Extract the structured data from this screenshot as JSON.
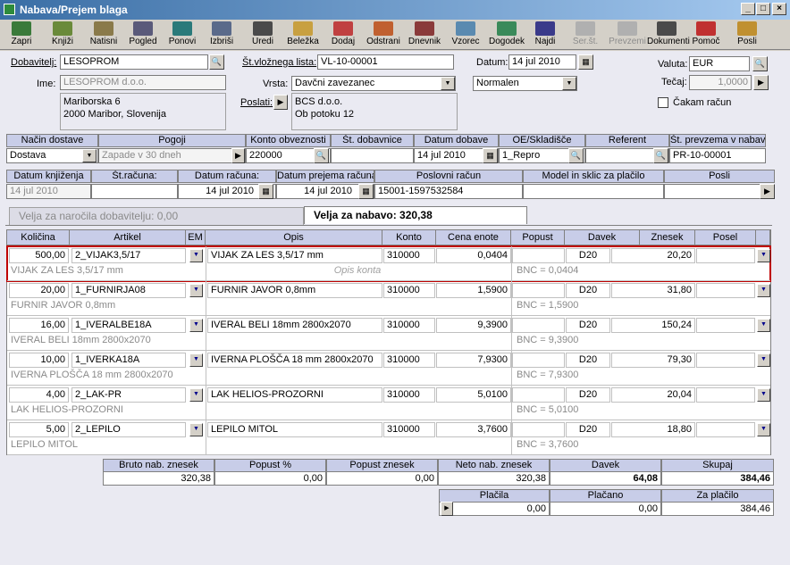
{
  "window": {
    "title": "Nabava/Prejem blaga"
  },
  "toolbar": [
    {
      "label": "Zapri",
      "icon": "close-door-icon",
      "color": "#3a7a3a",
      "enabled": true
    },
    {
      "label": "Knjiži",
      "icon": "book-icon",
      "color": "#6a8a3a",
      "enabled": true
    },
    {
      "label": "Natisni",
      "icon": "print-icon",
      "color": "#8a7a4a",
      "enabled": true
    },
    {
      "label": "Pogled",
      "icon": "view-icon",
      "color": "#5a5a7a",
      "enabled": true
    },
    {
      "label": "Ponovi",
      "icon": "repeat-icon",
      "color": "#2a7a7a",
      "enabled": true
    },
    {
      "label": "Izbriši",
      "icon": "trash-icon",
      "color": "#5a6a8a",
      "enabled": true
    },
    {
      "label": "Uredi",
      "icon": "edit-icon",
      "color": "#4a4a4a",
      "enabled": true
    },
    {
      "label": "Beležka",
      "icon": "note-icon",
      "color": "#c8a040",
      "enabled": true
    },
    {
      "label": "Dodaj",
      "icon": "add-icon",
      "color": "#c04040",
      "enabled": true
    },
    {
      "label": "Odstrani",
      "icon": "remove-icon",
      "color": "#c06030",
      "enabled": true
    },
    {
      "label": "Dnevnik",
      "icon": "journal-icon",
      "color": "#8a3a3a",
      "enabled": true
    },
    {
      "label": "Vzorec",
      "icon": "template-icon",
      "color": "#5a8ab0",
      "enabled": true
    },
    {
      "label": "Dogodek",
      "icon": "event-icon",
      "color": "#3a8a5a",
      "enabled": true
    },
    {
      "label": "Najdi",
      "icon": "find-icon",
      "color": "#3a3a8a",
      "enabled": true
    },
    {
      "label": "Ser.št.",
      "icon": "serial-icon",
      "color": "#b0b0b0",
      "enabled": false
    },
    {
      "label": "Prevzemi",
      "icon": "receive-icon",
      "color": "#b0b0b0",
      "enabled": false
    },
    {
      "label": "Dokumenti",
      "icon": "documents-icon",
      "color": "#4a4a4a",
      "enabled": true
    },
    {
      "label": "Pomoč",
      "icon": "help-icon",
      "color": "#c03030",
      "enabled": true
    },
    {
      "label": "Posli",
      "icon": "deals-icon",
      "color": "#c09030",
      "enabled": true
    }
  ],
  "header": {
    "dobavitelj_label": "Dobavitelj:",
    "dobavitelj": "LESOPROM",
    "stvl_label": "Št.vložnega lista:",
    "stvl": "VL-10-00001",
    "datum_label": "Datum:",
    "datum": "14 jul 2010",
    "valuta_label": "Valuta:",
    "valuta": "EUR",
    "tecaj_label": "Tečaj:",
    "tecaj": "1,0000",
    "cakam_label": "Čakam račun",
    "ime_label": "Ime:",
    "ime": "LESOPROM d.o.o.",
    "naslov_line1": "Mariborska 6",
    "naslov_line2": "2000 Maribor, Slovenija",
    "vrsta_label": "Vrsta:",
    "vrsta": "Davčni zavezanec",
    "normalen": "Normalen",
    "poslati_label": "Poslati:",
    "poslati_line1": "BCS d.o.o.",
    "poslati_line2": "Ob potoku 12"
  },
  "info1": {
    "headers": [
      "Način dostave",
      "Pogoji",
      "Konto obveznosti",
      "Št. dobavnice",
      "Datum dobave",
      "OE/Skladišče",
      "Referent",
      "Št. prevzema v nabavi"
    ],
    "values": [
      "Dostava",
      "Zapade v 30 dneh",
      "220000",
      "",
      "14 jul 2010",
      "1_Repro",
      "",
      "PR-10-00001"
    ]
  },
  "info2": {
    "headers": [
      "Datum knjiženja",
      "Št.računa:",
      "Datum računa:",
      "Datum prejema računa",
      "Poslovni račun",
      "Model in sklic za plačilo",
      "Posli"
    ],
    "values": [
      "14 jul 2010",
      "",
      "14 jul 2010",
      "14 jul 2010",
      "15001-1597532584",
      "",
      ""
    ]
  },
  "tabs": {
    "inactive": "Velja za naročila dobavitelju: 0,00",
    "active": "Velja za nabavo:  320,38"
  },
  "grid": {
    "columns": [
      "Količina",
      "Artikel",
      "EM",
      "Opis",
      "Konto",
      "Cena enote",
      "Popust",
      "Davek",
      "Znesek",
      "Posel"
    ],
    "rows": [
      {
        "kolicina": "500,00",
        "artikel": "2_VIJAK3,5/17",
        "opis": "VIJAK ZA LES 3,5/17 mm",
        "konto": "310000",
        "cena": "0,0404",
        "popust": "",
        "davek": "D20",
        "znesek": "20,20",
        "posel": "",
        "sub_artikel": "VIJAK ZA LES 3,5/17 mm",
        "sub_opis": "Opis konta",
        "bnc": "BNC = 0,0404"
      },
      {
        "kolicina": "20,00",
        "artikel": "1_FURNIRJA08",
        "opis": "FURNIR JAVOR 0,8mm",
        "konto": "310000",
        "cena": "1,5900",
        "popust": "",
        "davek": "D20",
        "znesek": "31,80",
        "posel": "",
        "sub_artikel": "FURNIR JAVOR 0,8mm",
        "sub_opis": "",
        "bnc": "BNC = 1,5900"
      },
      {
        "kolicina": "16,00",
        "artikel": "1_IVERALBE18A",
        "opis": "IVERAL BELI 18mm 2800x2070",
        "konto": "310000",
        "cena": "9,3900",
        "popust": "",
        "davek": "D20",
        "znesek": "150,24",
        "posel": "",
        "sub_artikel": "IVERAL BELI 18mm 2800x2070",
        "sub_opis": "",
        "bnc": "BNC = 9,3900"
      },
      {
        "kolicina": "10,00",
        "artikel": "1_IVERKA18A",
        "opis": "IVERNA PLOŠČA 18 mm 2800x2070",
        "konto": "310000",
        "cena": "7,9300",
        "popust": "",
        "davek": "D20",
        "znesek": "79,30",
        "posel": "",
        "sub_artikel": "IVERNA PLOŠČA 18 mm 2800x2070",
        "sub_opis": "",
        "bnc": "BNC = 7,9300"
      },
      {
        "kolicina": "4,00",
        "artikel": "2_LAK-PR",
        "opis": "LAK HELIOS-PROZORNI",
        "konto": "310000",
        "cena": "5,0100",
        "popust": "",
        "davek": "D20",
        "znesek": "20,04",
        "posel": "",
        "sub_artikel": "LAK HELIOS-PROZORNI",
        "sub_opis": "",
        "bnc": "BNC = 5,0100"
      },
      {
        "kolicina": "5,00",
        "artikel": "2_LEPILO",
        "opis": "LEPILO MITOL",
        "konto": "310000",
        "cena": "3,7600",
        "popust": "",
        "davek": "D20",
        "znesek": "18,80",
        "posel": "",
        "sub_artikel": "LEPILO MITOL",
        "sub_opis": "",
        "bnc": "BNC = 3,7600"
      }
    ]
  },
  "totals": {
    "headers": [
      "Bruto nab. znesek",
      "Popust %",
      "Popust znesek",
      "Neto nab. znesek",
      "Davek",
      "Skupaj"
    ],
    "values": [
      "320,38",
      "0,00",
      "0,00",
      "320,38",
      "64,08",
      "384,46"
    ]
  },
  "payment": {
    "headers": [
      "Plačila",
      "Plačano",
      "Za plačilo"
    ],
    "values": [
      "0,00",
      "0,00",
      "384,46"
    ]
  },
  "colors": {
    "accent_blue": "#c8cde8",
    "selected_row_border": "#c00000",
    "title_start": "#3a6ea5",
    "title_end": "#a6caf0"
  }
}
